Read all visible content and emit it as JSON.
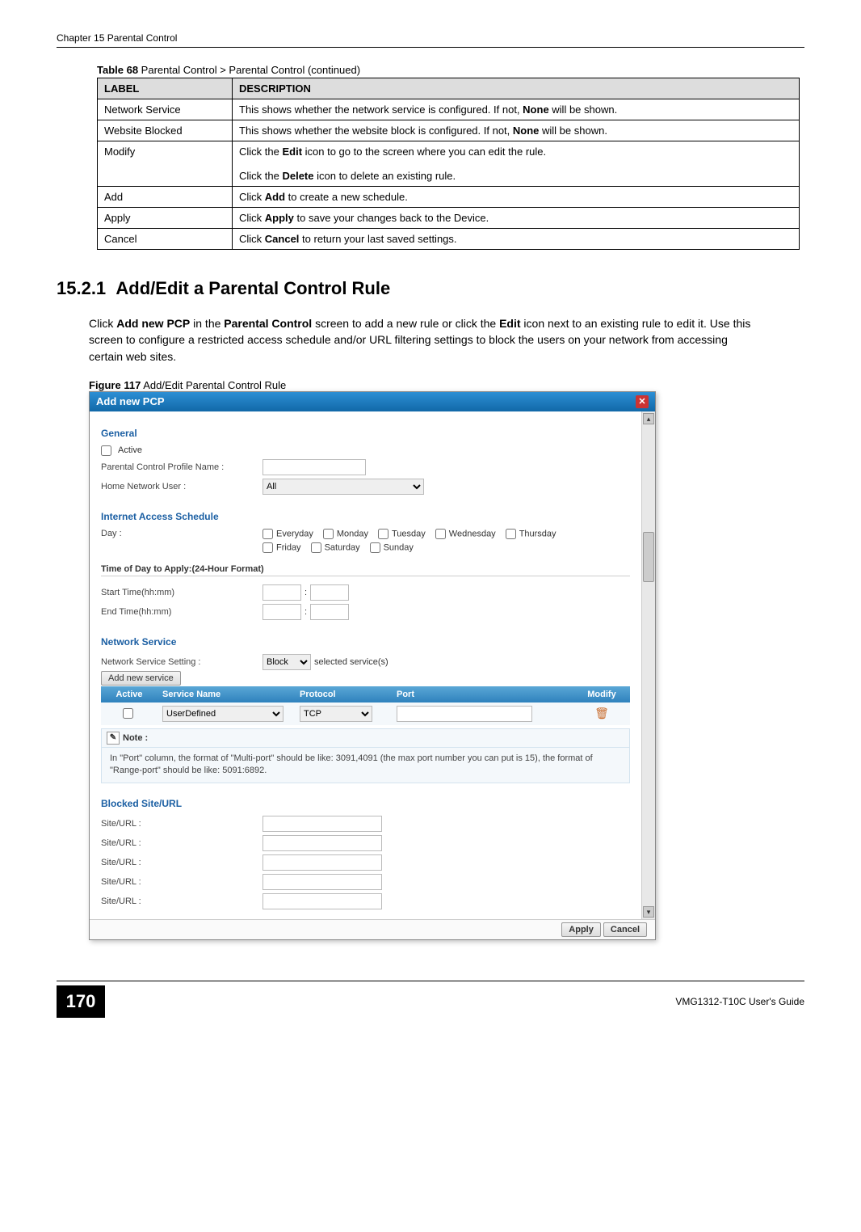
{
  "header": "Chapter 15 Parental Control",
  "table_caption_prefix": "Table 68",
  "table_caption_rest": "   Parental Control > Parental Control (continued)",
  "table": {
    "headers": [
      "LABEL",
      "DESCRIPTION"
    ],
    "rows": [
      {
        "label": "Network Service",
        "desc_parts": [
          "This shows whether the network service is configured. If not, ",
          "None",
          " will be shown."
        ]
      },
      {
        "label": "Website Blocked",
        "desc_parts": [
          "This shows whether the website block is configured. If not, ",
          "None",
          " will be shown."
        ]
      },
      {
        "label": "Modify",
        "desc_parts_multi": [
          [
            "Click the ",
            "Edit",
            " icon to go to the screen where you can edit the rule."
          ],
          [
            "Click the ",
            "Delete",
            " icon to delete an existing rule."
          ]
        ]
      },
      {
        "label": "Add",
        "desc_parts": [
          "Click ",
          "Add",
          " to create a new schedule."
        ]
      },
      {
        "label": "Apply",
        "desc_parts": [
          "Click ",
          "Apply",
          " to save your changes back to the Device."
        ]
      },
      {
        "label": "Cancel",
        "desc_parts": [
          "Click ",
          "Cancel",
          " to return your last saved settings."
        ]
      }
    ]
  },
  "section": {
    "number": "15.2.1",
    "title": "Add/Edit a Parental Control Rule",
    "para_parts": [
      "Click ",
      "Add new PCP",
      " in the ",
      "Parental Control",
      " screen to add a new rule or click the ",
      "Edit",
      " icon next to an existing rule to edit it. Use this screen to configure a restricted access schedule and/or URL filtering settings to block the users on your network from accessing certain web sites."
    ]
  },
  "figure_caption_prefix": "Figure 117",
  "figure_caption_rest": "   Add/Edit Parental Control Rule",
  "dialog": {
    "title": "Add new PCP",
    "general": {
      "heading": "General",
      "active_label": "Active",
      "profile_name_label": "Parental Control Profile Name :",
      "home_user_label": "Home Network User :",
      "home_user_value": "All"
    },
    "schedule": {
      "heading": "Internet Access Schedule",
      "day_label": "Day :",
      "days": [
        "Everyday",
        "Monday",
        "Tuesday",
        "Wednesday",
        "Thursday",
        "Friday",
        "Saturday",
        "Sunday"
      ],
      "time_heading": "Time of Day to Apply:(24-Hour Format)",
      "start_label": "Start Time(hh:mm)",
      "end_label": "End Time(hh:mm)"
    },
    "service": {
      "heading": "Network Service",
      "setting_label": "Network Service Setting :",
      "setting_value": "Block",
      "setting_suffix": "selected service(s)",
      "add_btn": "Add new service",
      "cols": [
        "Active",
        "Service Name",
        "Protocol",
        "Port",
        "Modify"
      ],
      "row": {
        "service_name": "UserDefined",
        "protocol": "TCP"
      },
      "note_label": "Note :",
      "note_text": "In \"Port\" column, the format of \"Multi-port\" should be like: 3091,4091 (the max port number you can put is 15), the format of \"Range-port\" should be like: 5091:6892."
    },
    "blocked": {
      "heading": "Blocked Site/URL",
      "label": "Site/URL :",
      "count": 5
    },
    "footer": {
      "apply": "Apply",
      "cancel": "Cancel"
    }
  },
  "page_footer": {
    "page": "170",
    "guide": "VMG1312-T10C User's Guide"
  }
}
